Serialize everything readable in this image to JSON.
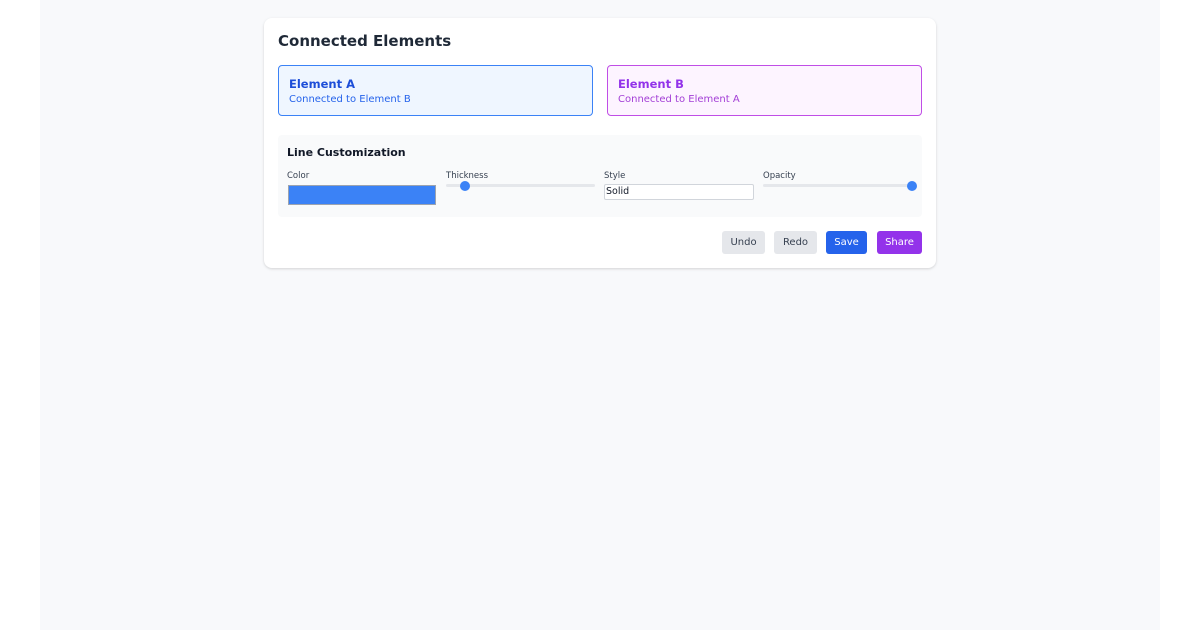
{
  "panel_title": "Connected Elements",
  "elements": [
    {
      "name": "Element A",
      "description": "Connected to Element B"
    },
    {
      "name": "Element B",
      "description": "Connected to Element A"
    }
  ],
  "line_customization": {
    "title": "Line Customization",
    "color": {
      "label": "Color",
      "value": "#3b82f6"
    },
    "thickness": {
      "label": "Thickness",
      "level": 0.13
    },
    "style": {
      "label": "Style",
      "value": "Solid"
    },
    "opacity": {
      "label": "Opacity",
      "level": 1.0
    }
  },
  "actions": {
    "undo": "Undo",
    "redo": "Redo",
    "save": "Save",
    "share": "Share"
  },
  "colors": {
    "element_a_accent": "#3b82f6",
    "element_b_accent": "#c04ee6",
    "save": "#2563eb",
    "share": "#9333ea"
  }
}
